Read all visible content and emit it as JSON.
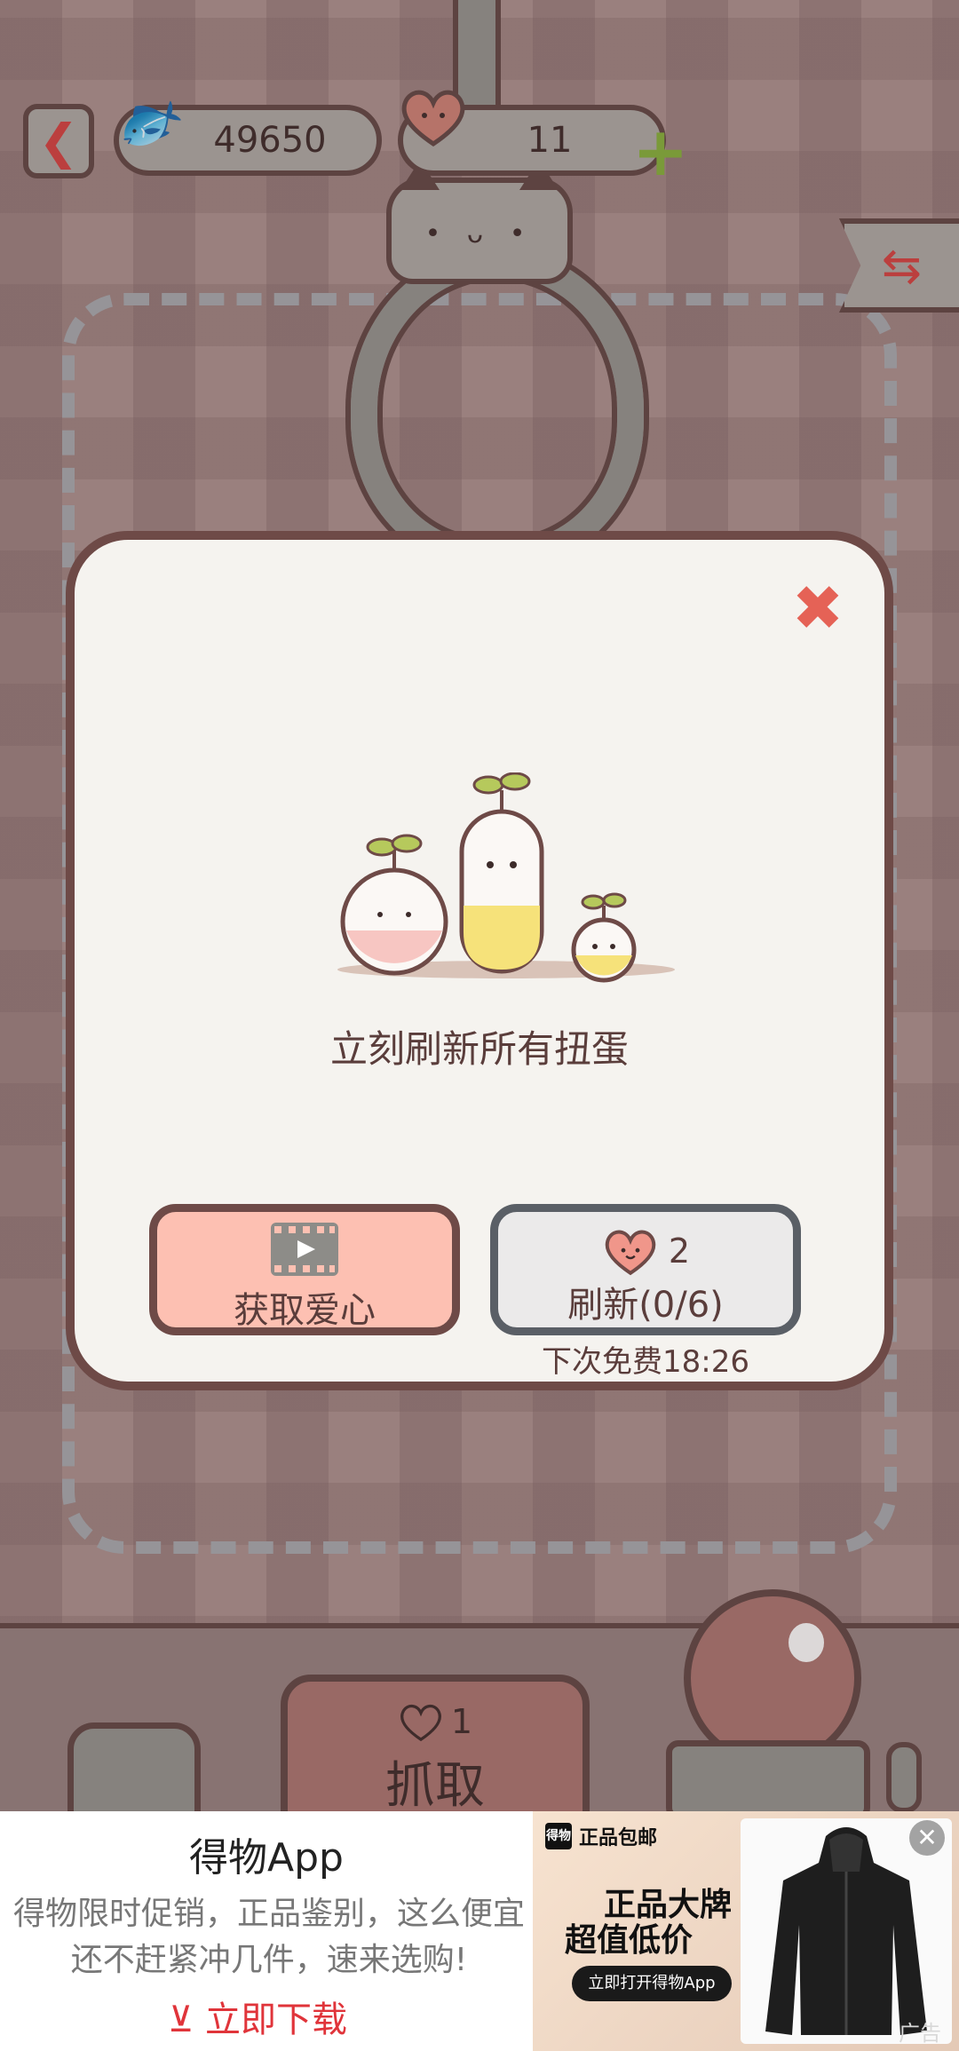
{
  "hud": {
    "back_icon": "chevron-left",
    "fish_icon": "fish",
    "fish_count": "49650",
    "heart_icon": "heart",
    "heart_count": "11",
    "plus_icon": "plus",
    "refresh_icon": "refresh-arrows"
  },
  "modal": {
    "close_icon": "close-x",
    "illustration": "sprouts",
    "message": "立刻刷新所有扭蛋",
    "video_button": {
      "icon": "film-play",
      "label": "获取爱心"
    },
    "refresh_button": {
      "cost_icon": "heart",
      "cost": "2",
      "label": "刷新(0/6)"
    },
    "free_timer": "下次免费18:26"
  },
  "game_controls": {
    "grab_cost": "1",
    "grab_label": "抓取"
  },
  "ad": {
    "title": "得物App",
    "description": "得物限时促销，正品鉴别，这么便宜还不赶紧冲几件，速来选购!",
    "cta": "⊻ 立即下载",
    "badge_logo": "得物",
    "badge_text": "正品包邮",
    "headline_1": "正品大牌",
    "headline_2": "超值低价",
    "open_button": "立即打开得物App",
    "close_icon": "close-circle",
    "ad_mark": "广告"
  },
  "colors": {
    "modal_border": "#6e4a47",
    "modal_bg": "#f5f3ef",
    "video_button_bg": "#fdc0b2",
    "refresh_button_bg": "#ebeaea",
    "close_x": "#e56256",
    "ad_cta": "#e0343a"
  }
}
